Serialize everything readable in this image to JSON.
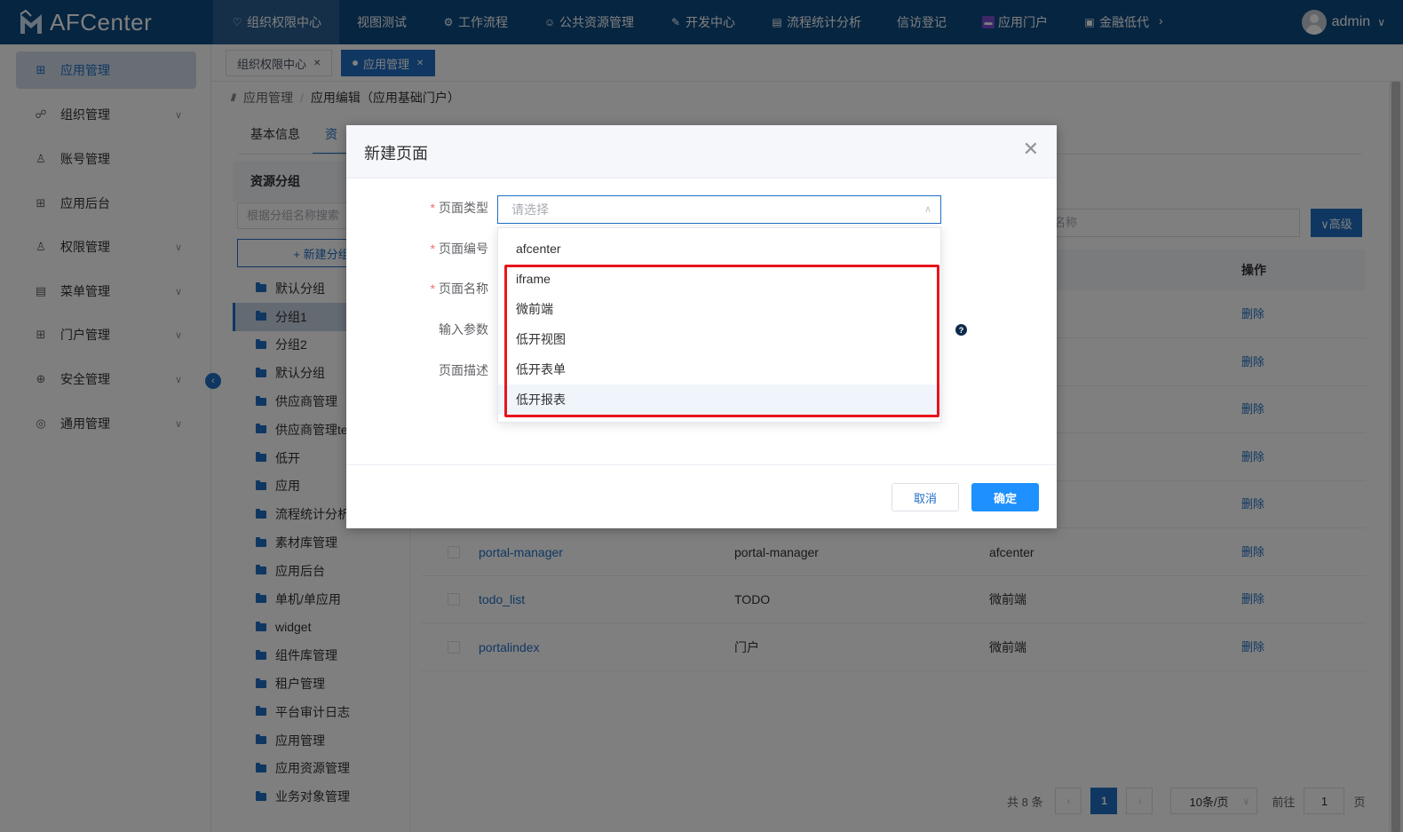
{
  "brand": {
    "name": "AFCenter"
  },
  "nav": {
    "items": [
      {
        "label": "组织权限中心",
        "icon": "shield-icon"
      },
      {
        "label": "视图测试",
        "icon": ""
      },
      {
        "label": "工作流程",
        "icon": "workflow-icon"
      },
      {
        "label": "公共资源管理",
        "icon": "users-icon"
      },
      {
        "label": "开发中心",
        "icon": "edit-icon"
      },
      {
        "label": "流程统计分析",
        "icon": "table-icon"
      },
      {
        "label": "信访登记",
        "icon": ""
      },
      {
        "label": "应用门户",
        "icon": "portal-icon"
      },
      {
        "label": "金融低代",
        "icon": "image-icon"
      }
    ],
    "user": "admin"
  },
  "sidebar": {
    "items": [
      {
        "label": "应用管理",
        "icon": "grid-icon",
        "active": true
      },
      {
        "label": "组织管理",
        "icon": "org-icon"
      },
      {
        "label": "账号管理",
        "icon": "user-icon"
      },
      {
        "label": "应用后台",
        "icon": "grid-icon"
      },
      {
        "label": "权限管理",
        "icon": "permission-icon"
      },
      {
        "label": "菜单管理",
        "icon": "menu-icon"
      },
      {
        "label": "门户管理",
        "icon": "grid-icon"
      },
      {
        "label": "安全管理",
        "icon": "security-icon"
      },
      {
        "label": "通用管理",
        "icon": "settings-icon"
      }
    ]
  },
  "tabs": [
    {
      "label": "组织权限中心"
    },
    {
      "label": "应用管理"
    }
  ],
  "breadcrumb": {
    "parent": "应用管理",
    "sep": "/",
    "current": "应用编辑（应用基础门户）"
  },
  "content": {
    "tabs": [
      "基本信息",
      "资"
    ],
    "group_panel": {
      "title": "资源分组",
      "search_placeholder": "根据分组名称搜索",
      "add_label": "+ 新建分组",
      "items": [
        "默认分组",
        "分组1",
        "分组2",
        "默认分组",
        "供应商管理",
        "供应商管理te",
        "低开",
        "应用",
        "流程统计分析",
        "素材库管理",
        "应用后台",
        "单机/单应用",
        "widget",
        "组件库管理",
        "租户管理",
        "平台审计日志",
        "应用管理",
        "应用资源管理",
        "业务对象管理"
      ]
    },
    "filter_placeholder": "名称",
    "advanced_label": "∨高级",
    "table": {
      "op_header": "操作",
      "rows": [
        {
          "name": "",
          "code": "",
          "type": "",
          "op": "删除"
        },
        {
          "name": "",
          "code": "",
          "type": "",
          "op": "删除"
        },
        {
          "name": "",
          "code": "",
          "type": "",
          "op": "删除"
        },
        {
          "name": "",
          "code": "",
          "type": "",
          "op": "删除"
        },
        {
          "name": "",
          "code": "",
          "type": "",
          "op": "删除"
        },
        {
          "name": "portal-manager",
          "code": "portal-manager",
          "type": "afcenter",
          "op": "删除"
        },
        {
          "name": "todo_list",
          "code": "TODO",
          "type": "微前端",
          "op": "删除"
        },
        {
          "name": "portalindex",
          "code": "门户",
          "type": "微前端",
          "op": "删除"
        }
      ]
    },
    "pager": {
      "total": "共 8 条",
      "current": "1",
      "page_size": "10条/页",
      "goto_label": "前往",
      "goto_value": "1",
      "page_unit": "页"
    }
  },
  "dialog": {
    "title": "新建页面",
    "fields": {
      "page_type": "页面类型",
      "page_code": "页面编号",
      "page_name": "页面名称",
      "input_params": "输入参数",
      "page_desc": "页面描述"
    },
    "select_placeholder": "请选择",
    "options": [
      "afcenter",
      "iframe",
      "微前端",
      "低开视图",
      "低开表单",
      "低开报表"
    ],
    "cancel_label": "取消",
    "ok_label": "确定"
  }
}
